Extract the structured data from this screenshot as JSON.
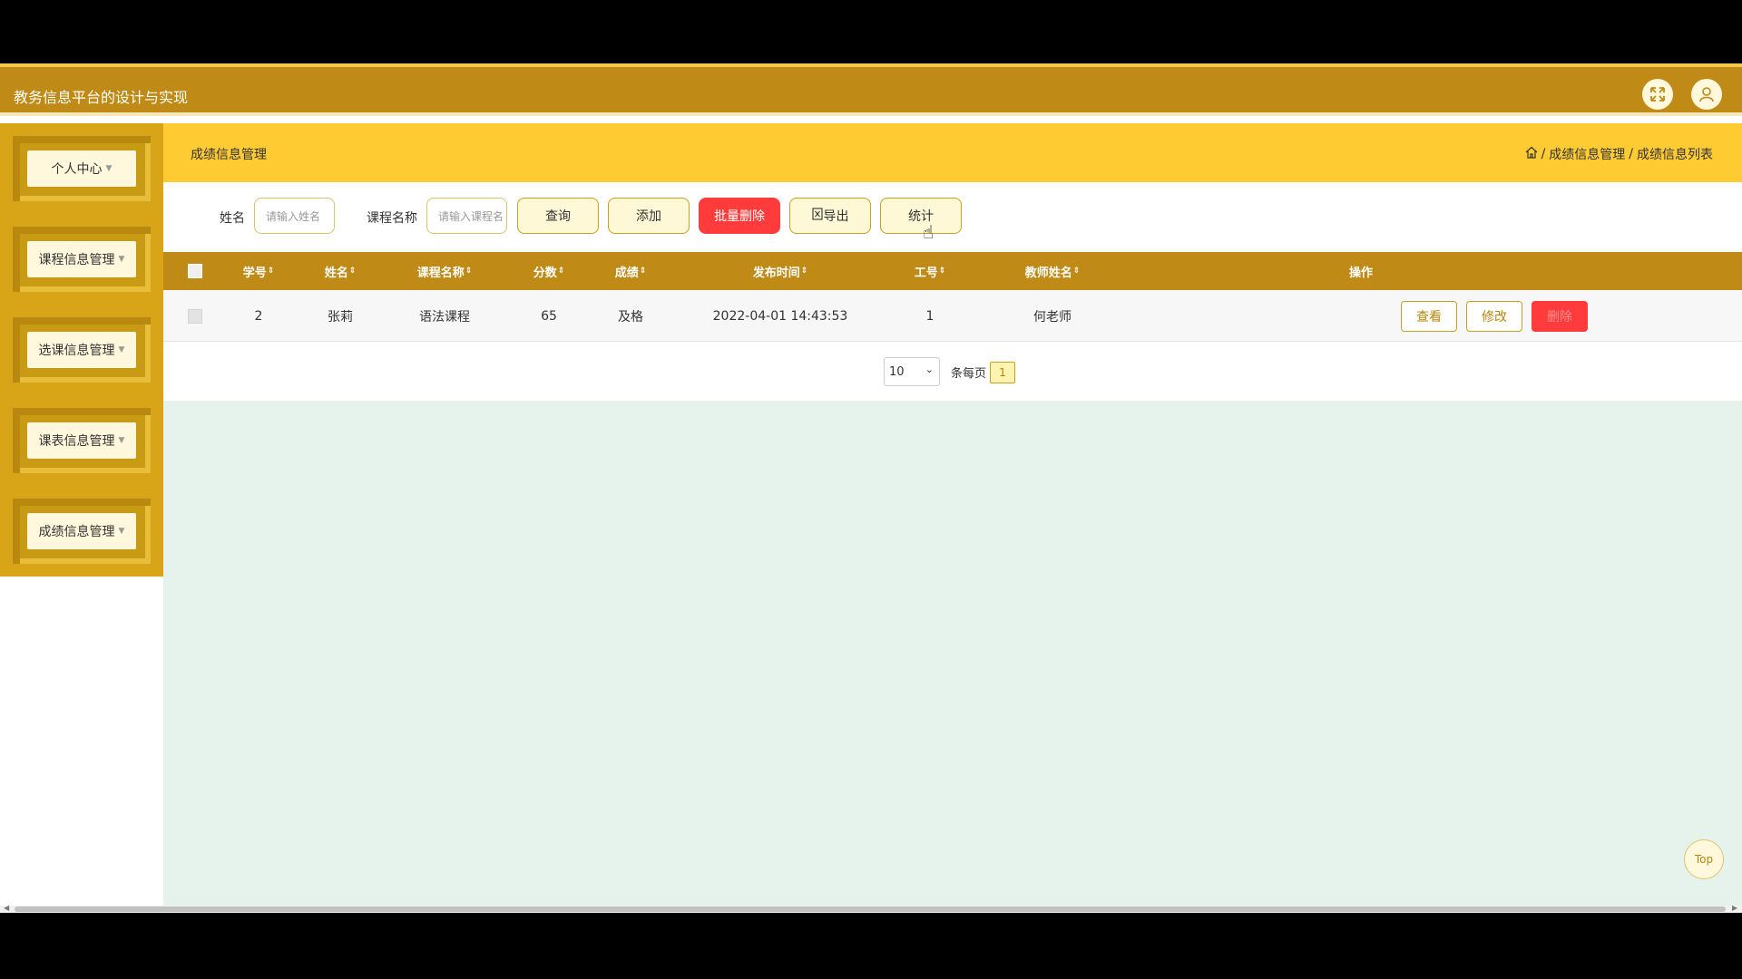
{
  "app": {
    "title": "教务信息平台的设计与实现"
  },
  "sidebar": {
    "items": [
      {
        "label": "个人中心"
      },
      {
        "label": "课程信息管理"
      },
      {
        "label": "选课信息管理"
      },
      {
        "label": "课表信息管理"
      },
      {
        "label": "成绩信息管理"
      }
    ]
  },
  "breadcrumb": {
    "page_title": "成绩信息管理",
    "path": [
      "成绩信息管理",
      "成绩信息列表"
    ],
    "separator": "/"
  },
  "search": {
    "name_label": "姓名",
    "name_placeholder": "请输入姓名",
    "course_label": "课程名称",
    "course_placeholder": "请输入课程名",
    "query_label": "查询",
    "add_label": "添加",
    "batch_delete_label": "批量删除",
    "export_label": "导出",
    "stats_label": "统计"
  },
  "table": {
    "columns": [
      "学号",
      "姓名",
      "课程名称",
      "分数",
      "成绩",
      "发布时间",
      "工号",
      "教师姓名",
      "操作"
    ],
    "rows": [
      {
        "student_id": "2",
        "name": "张莉",
        "course": "语法课程",
        "score": "65",
        "grade": "及格",
        "time": "2022-04-01 14:43:53",
        "teacher_id": "1",
        "teacher_name": "何老师"
      }
    ],
    "actions": {
      "view": "查看",
      "edit": "修改",
      "delete": "删除"
    }
  },
  "pager": {
    "page_size": "10",
    "page_size_label": "条每页",
    "current_page": "1"
  },
  "top_button": "Top",
  "colors": {
    "header": "#bf8a16",
    "accent": "#ffcb33",
    "danger": "#ff3b3b",
    "content_bg": "#e6f2ec"
  }
}
